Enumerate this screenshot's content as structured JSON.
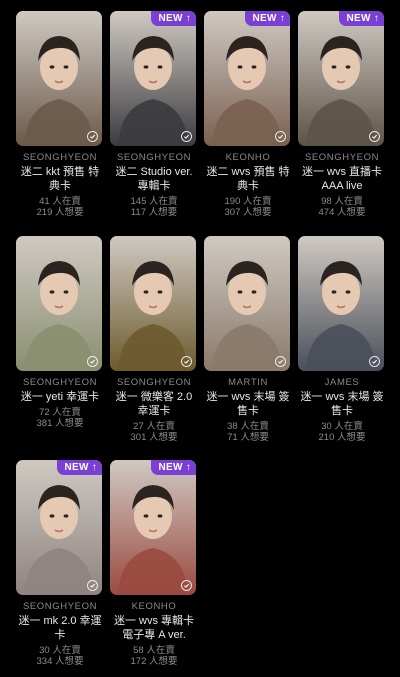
{
  "new_badge": "NEW",
  "cards": [
    {
      "member": "SEONGHYEON",
      "title": "迷二 kkt 預售 特典卡",
      "owned": "41 人在賣",
      "wanted": "219 人想要",
      "is_new": false,
      "tone": "#6b5a4a"
    },
    {
      "member": "SEONGHYEON",
      "title": "迷二 Studio ver. 專輯卡",
      "owned": "145 人在賣",
      "wanted": "117 人想要",
      "is_new": true,
      "tone": "#3b3b3f"
    },
    {
      "member": "KEONHO",
      "title": "迷二 wvs 預售 特典卡",
      "owned": "190 人在賣",
      "wanted": "307 人想要",
      "is_new": true,
      "tone": "#7a6050"
    },
    {
      "member": "SEONGHYEON",
      "title": "迷一 wvs 直播卡 AAA live",
      "owned": "98 人在賣",
      "wanted": "474 人想要",
      "is_new": true,
      "tone": "#5d5347"
    },
    {
      "member": "SEONGHYEON",
      "title": "迷一 yeti 幸運卡",
      "owned": "72 人在賣",
      "wanted": "381 人想要",
      "is_new": false,
      "tone": "#8a8f70"
    },
    {
      "member": "SEONGHYEON",
      "title": "迷一 微樂客 2.0 幸運卡",
      "owned": "27 人在賣",
      "wanted": "301 人想要",
      "is_new": false,
      "tone": "#6d5a2e"
    },
    {
      "member": "MARTIN",
      "title": "迷一 wvs 末場 簽售卡",
      "owned": "38 人在賣",
      "wanted": "71 人想要",
      "is_new": false,
      "tone": "#8a7a6a"
    },
    {
      "member": "JAMES",
      "title": "迷一 wvs 末場 簽售卡",
      "owned": "30 人在賣",
      "wanted": "210 人想要",
      "is_new": false,
      "tone": "#4a4f5a"
    },
    {
      "member": "SEONGHYEON",
      "title": "迷一 mk 2.0 幸運卡",
      "owned": "30 人在賣",
      "wanted": "334 人想要",
      "is_new": true,
      "tone": "#8f8480"
    },
    {
      "member": "KEONHO",
      "title": "迷一 wvs 專輯卡 電子專 A ver.",
      "owned": "58 人在賣",
      "wanted": "172 人想要",
      "is_new": true,
      "tone": "#9a4a40"
    }
  ]
}
